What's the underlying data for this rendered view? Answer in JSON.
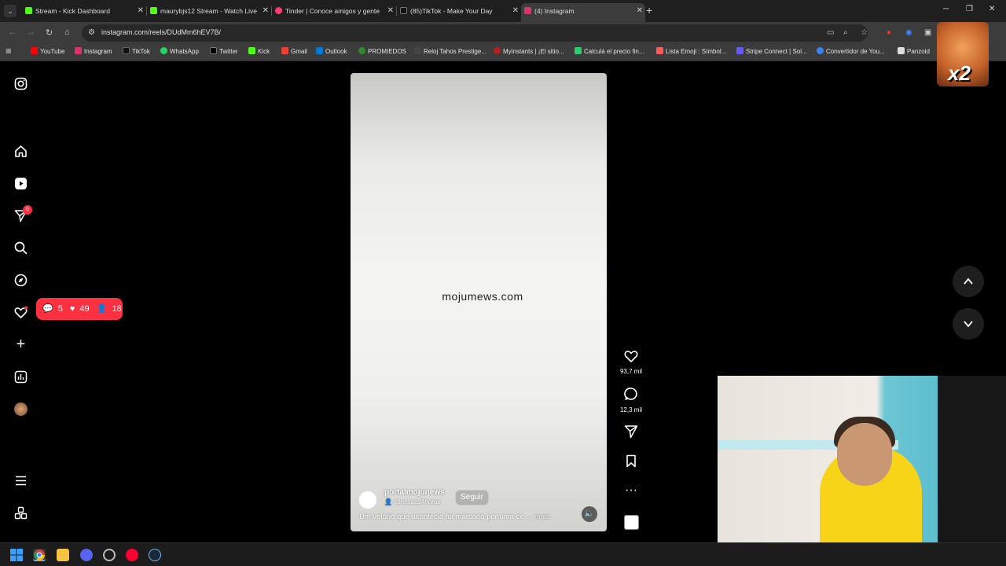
{
  "tabs": [
    {
      "title": "Stream - Kick Dashboard",
      "favicon_color": "#53fc18",
      "active": false
    },
    {
      "title": "maurybjs12 Stream - Watch Live",
      "favicon_color": "#53fc18",
      "active": false
    },
    {
      "title": "Tinder | Conoce amigos y gente",
      "favicon_color": "#fe3c72",
      "active": false
    },
    {
      "title": "(85)TikTok - Make Your Day",
      "favicon_color": "#111111",
      "active": false
    },
    {
      "title": "(4) Instagram",
      "favicon_color": "#e1306c",
      "active": true
    }
  ],
  "address": {
    "url": "instagram.com/reels/DUdMm6hEV7B/"
  },
  "bookmarks": [
    {
      "label": "YouTube",
      "color": "#ff0000"
    },
    {
      "label": "Instagram",
      "color": "#e1306c"
    },
    {
      "label": "TikTok",
      "color": "#111111"
    },
    {
      "label": "WhatsApp",
      "color": "#25d366"
    },
    {
      "label": "Twitter",
      "color": "#000000"
    },
    {
      "label": "Kick",
      "color": "#53fc18"
    },
    {
      "label": "Gmail",
      "color": "#ea4335"
    },
    {
      "label": "Outlook",
      "color": "#0078d4"
    },
    {
      "label": "PROMIEDOS",
      "color": "#2e8b2e"
    },
    {
      "label": "Reloj Tahos Prestige...",
      "color": "#444444"
    },
    {
      "label": "Myinstants | ¡El sitio...",
      "color": "#b22222"
    },
    {
      "label": "Calculá el precio fin...",
      "color": "#2ecc71"
    },
    {
      "label": "Lista Emoji : Símbol...",
      "color": "#ff5a5a"
    },
    {
      "label": "Stripe Connect | Sol...",
      "color": "#635bff"
    },
    {
      "label": "Convertidor de You...",
      "color": "#3b82f6"
    },
    {
      "label": "Panzoid",
      "color": "#dddddd"
    }
  ],
  "overlay": {
    "multiplier": "x2"
  },
  "sidebar": {
    "notifications_badge": "6",
    "activity_pill": {
      "comments": "5",
      "likes": "49",
      "follows": "18"
    }
  },
  "reel": {
    "watermark": "mojumews.com",
    "author": "portalmojunews",
    "audio": "conexao24horas",
    "follow_label": "Seguir",
    "caption": "Um velório que acontecia foi marcado por uma ce ...",
    "more_label": "mais"
  },
  "actions": {
    "likes": "93,7 mil",
    "comments": "12,3 mil"
  }
}
